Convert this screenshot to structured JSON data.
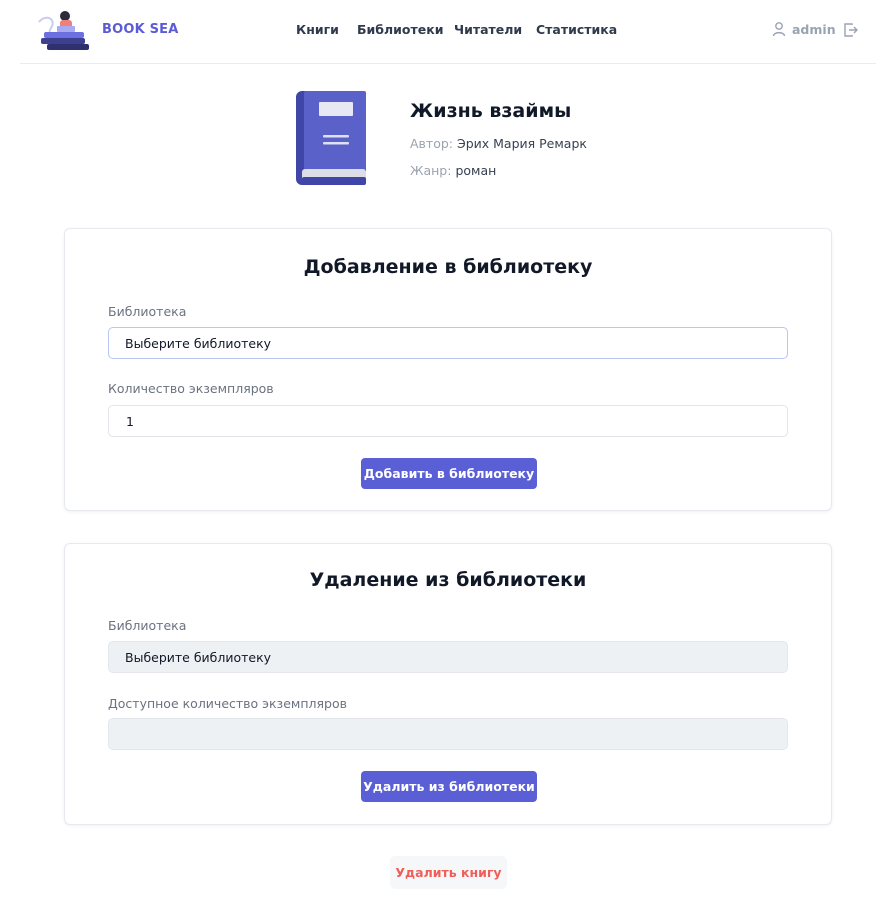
{
  "header": {
    "brand": "BOOK SEA",
    "nav": [
      "Книги",
      "Библиотеки",
      "Читатели",
      "Статистика"
    ],
    "user": "admin",
    "icons": {
      "user": "user-icon",
      "logout": "logout-icon",
      "logo": "reader-logo-icon"
    }
  },
  "book": {
    "title": "Жизнь взаймы",
    "author_label": "Автор:",
    "author": "Эрих Мария Ремарк",
    "genre_label": "Жанр:",
    "genre": "роман",
    "cover_color": "#5a61c8"
  },
  "add_section": {
    "title": "Добавление в библиотеку",
    "library_label": "Библиотека",
    "library_value": "Выберите библиотеку",
    "count_label": "Количество экземпляров",
    "count_value": "1",
    "button": "Добавить в библиотеку"
  },
  "remove_section": {
    "title": "Удаление из библиотеки",
    "library_label": "Библиотека",
    "library_value": "Выберите библиотеку",
    "count_label": "Доступное количество экземпляров",
    "count_value": "",
    "button": "Удалить из библиотеки"
  },
  "delete_button": "Удалить книгу",
  "colors": {
    "accent": "#5b5fd6",
    "danger": "#ef5f59"
  }
}
